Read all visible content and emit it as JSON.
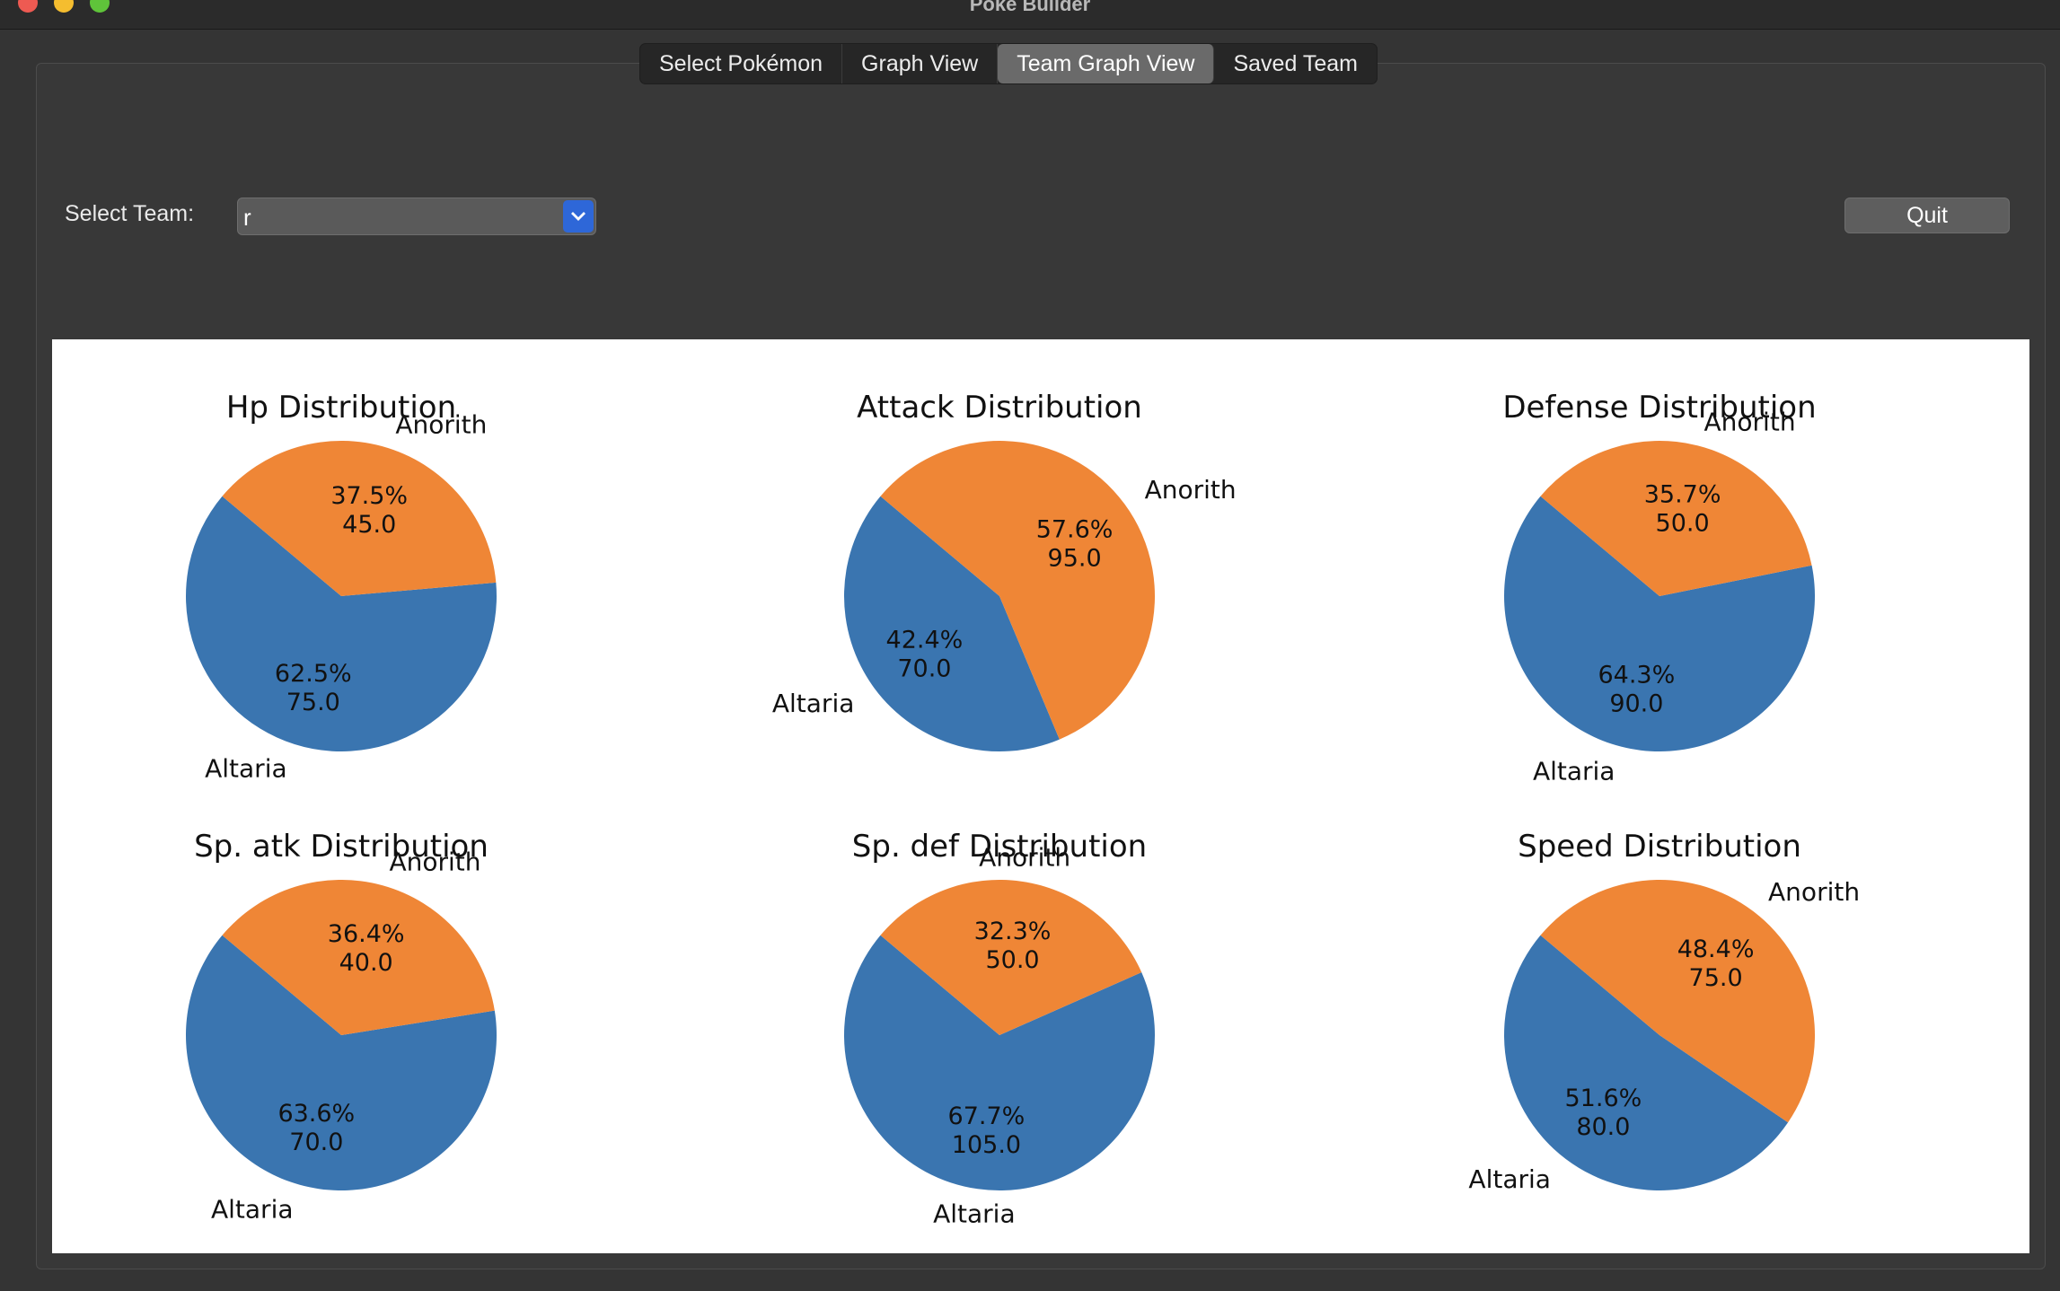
{
  "window": {
    "title": "Poke Builder"
  },
  "tabs": [
    {
      "label": "Select Pokémon",
      "active": false
    },
    {
      "label": "Graph View",
      "active": false
    },
    {
      "label": "Team Graph View",
      "active": true
    },
    {
      "label": "Saved Team",
      "active": false
    }
  ],
  "team_select": {
    "label": "Select Team:",
    "value": "r"
  },
  "quit_label": "Quit",
  "colors": {
    "altaria": "#3a75b0",
    "anorith": "#ef8636",
    "selected_tab": "#6a6a6a",
    "dropdown_accent": "#2e67d8"
  },
  "chart_data": [
    {
      "type": "pie",
      "title": "Hp Distribution",
      "labels": [
        "Altaria",
        "Anorith"
      ],
      "values": [
        75.0,
        45.0
      ],
      "percent": [
        "62.5%",
        "37.5%"
      ],
      "value_text": [
        "75.0",
        "45.0"
      ]
    },
    {
      "type": "pie",
      "title": "Attack Distribution",
      "labels": [
        "Altaria",
        "Anorith"
      ],
      "values": [
        70.0,
        95.0
      ],
      "percent": [
        "42.4%",
        "57.6%"
      ],
      "value_text": [
        "70.0",
        "95.0"
      ]
    },
    {
      "type": "pie",
      "title": "Defense Distribution",
      "labels": [
        "Altaria",
        "Anorith"
      ],
      "values": [
        90.0,
        50.0
      ],
      "percent": [
        "64.3%",
        "35.7%"
      ],
      "value_text": [
        "90.0",
        "50.0"
      ]
    },
    {
      "type": "pie",
      "title": "Sp. atk Distribution",
      "labels": [
        "Altaria",
        "Anorith"
      ],
      "values": [
        70.0,
        40.0
      ],
      "percent": [
        "63.6%",
        "36.4%"
      ],
      "value_text": [
        "70.0",
        "40.0"
      ]
    },
    {
      "type": "pie",
      "title": "Sp. def Distribution",
      "labels": [
        "Altaria",
        "Anorith"
      ],
      "values": [
        105.0,
        50.0
      ],
      "percent": [
        "67.7%",
        "32.3%"
      ],
      "value_text": [
        "105.0",
        "50.0"
      ]
    },
    {
      "type": "pie",
      "title": "Speed Distribution",
      "labels": [
        "Altaria",
        "Anorith"
      ],
      "values": [
        80.0,
        75.0
      ],
      "percent": [
        "51.6%",
        "48.4%"
      ],
      "value_text": [
        "80.0",
        "75.0"
      ]
    }
  ]
}
